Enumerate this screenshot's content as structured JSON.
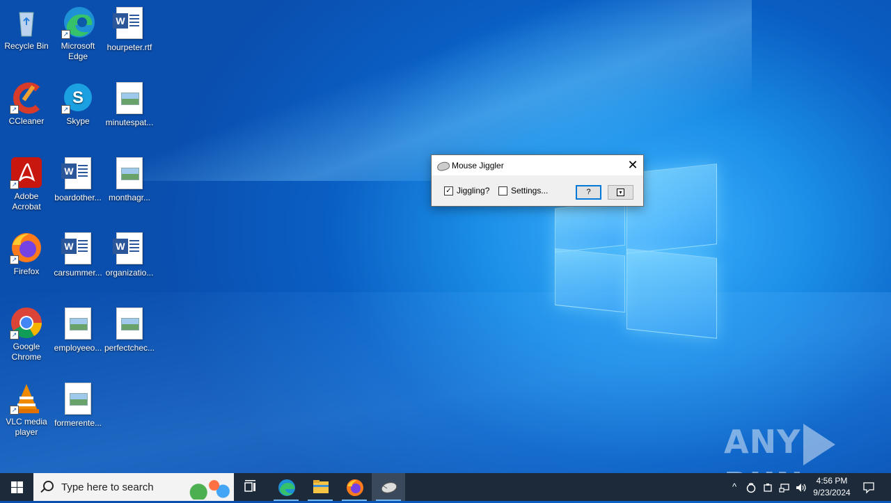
{
  "desktop": {
    "icons": [
      {
        "label": "Recycle Bin",
        "icon": "recycle-bin-icon"
      },
      {
        "label": "Microsoft Edge",
        "icon": "edge-icon"
      },
      {
        "label": "hourpeter.rtf",
        "icon": "word-doc-icon"
      },
      {
        "label": "CCleaner",
        "icon": "ccleaner-icon"
      },
      {
        "label": "Skype",
        "icon": "skype-icon"
      },
      {
        "label": "minutespat...",
        "icon": "image-file-icon"
      },
      {
        "label": "Adobe Acrobat",
        "icon": "acrobat-icon"
      },
      {
        "label": "boardother...",
        "icon": "word-doc-icon"
      },
      {
        "label": "monthagr...",
        "icon": "image-file-icon"
      },
      {
        "label": "Firefox",
        "icon": "firefox-icon"
      },
      {
        "label": "carsummer...",
        "icon": "word-doc-icon"
      },
      {
        "label": "organizatio...",
        "icon": "word-doc-icon"
      },
      {
        "label": "Google Chrome",
        "icon": "chrome-icon"
      },
      {
        "label": "employeeo...",
        "icon": "image-file-icon"
      },
      {
        "label": "perfectchec...",
        "icon": "image-file-icon"
      },
      {
        "label": "VLC media player",
        "icon": "vlc-icon"
      },
      {
        "label": "formerente...",
        "icon": "image-file-icon"
      }
    ]
  },
  "dialog": {
    "title": "Mouse Jiggler",
    "close_glyph": "✕",
    "jiggling_label": "Jiggling?",
    "jiggling_checked": true,
    "check_glyph": "✓",
    "settings_label": "Settings...",
    "settings_checked": false,
    "help_label": "?",
    "minimize_glyph": "▾"
  },
  "watermark": {
    "left": "ANY",
    "right": "RUN"
  },
  "taskbar": {
    "search_placeholder": "Type here to search",
    "apps": [
      "task-view-icon",
      "edge-icon",
      "file-explorer-icon",
      "firefox-icon",
      "mouse-jiggler-icon"
    ],
    "tray_caret": "^",
    "time": "4:56 PM",
    "date": "9/23/2024"
  }
}
